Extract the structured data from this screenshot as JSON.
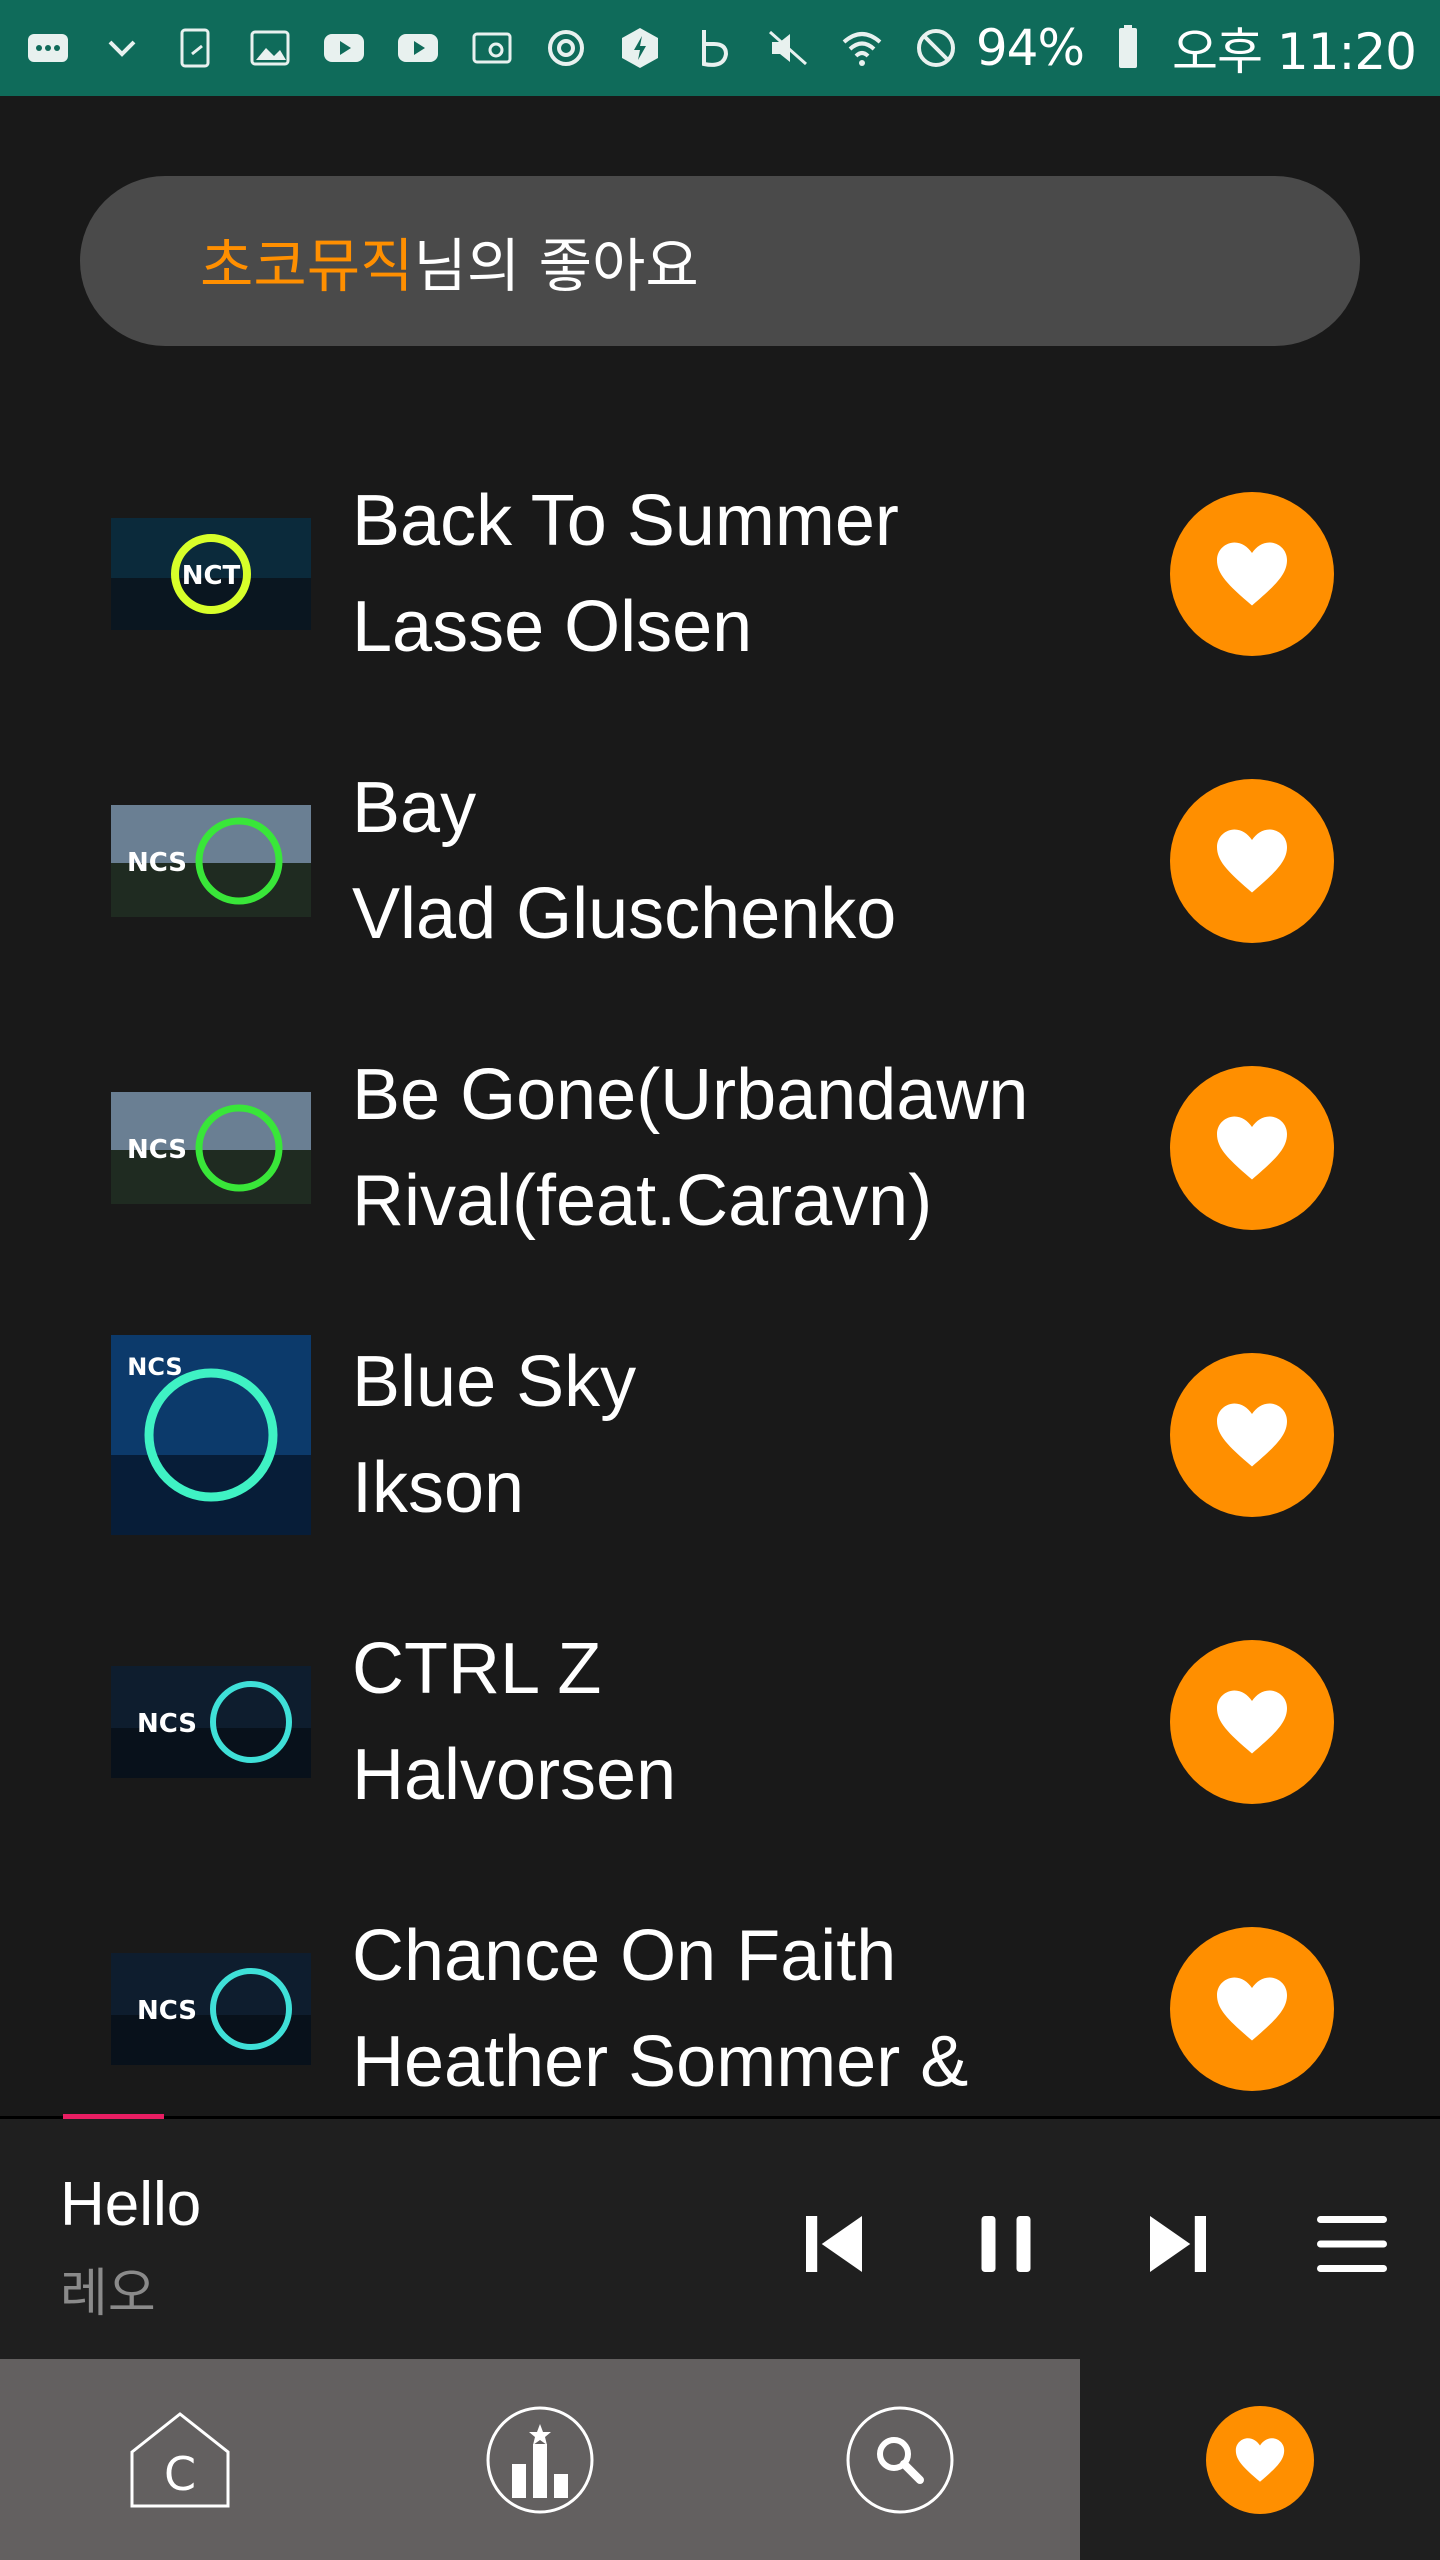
{
  "status_bar": {
    "battery": "94%",
    "time": "오후 11:20",
    "icons": [
      "message-icon",
      "chevron-down-icon",
      "screenshot-icon",
      "image-icon",
      "youtube-icon",
      "youtube-icon",
      "wifi-call-icon",
      "sync-icon",
      "power-saving-icon",
      "b-app-icon",
      "mute-icon",
      "wifi-icon",
      "do-not-disturb-icon",
      "battery-icon"
    ]
  },
  "header": {
    "owner_name": "초코뮤직",
    "suffix": "님의 좋아요"
  },
  "tracks": [
    {
      "title": "Back To Summer",
      "artist": "Lasse Olsen",
      "thumb": "NCT"
    },
    {
      "title": "Bay",
      "artist": "Vlad Gluschenko",
      "thumb": "NCS"
    },
    {
      "title": "Be Gone(Urbandawn",
      "artist": "Rival(feat.Caravn)",
      "thumb": "NCS"
    },
    {
      "title": "Blue Sky",
      "artist": "Ikson",
      "thumb": "NCS"
    },
    {
      "title": "CTRL Z",
      "artist": "Halvorsen",
      "thumb": "NCS"
    },
    {
      "title": "Chance On Faith",
      "artist": "Heather Sommer &",
      "thumb": "NCS"
    }
  ],
  "now_playing": {
    "title": "Hello",
    "artist": "레오",
    "progress": 0.07
  },
  "controls": [
    "previous-icon",
    "pause-icon",
    "next-icon",
    "queue-menu-icon"
  ],
  "bottom_nav": [
    "home-icon",
    "chart-icon",
    "search-icon",
    "favorites-icon"
  ],
  "colors": {
    "accent": "#ff8f00",
    "status_bar": "#0f6b5a",
    "background": "#191919",
    "header_pill": "#4a4a4a",
    "progress": "#e91e63",
    "nav_bg": "#636060"
  }
}
